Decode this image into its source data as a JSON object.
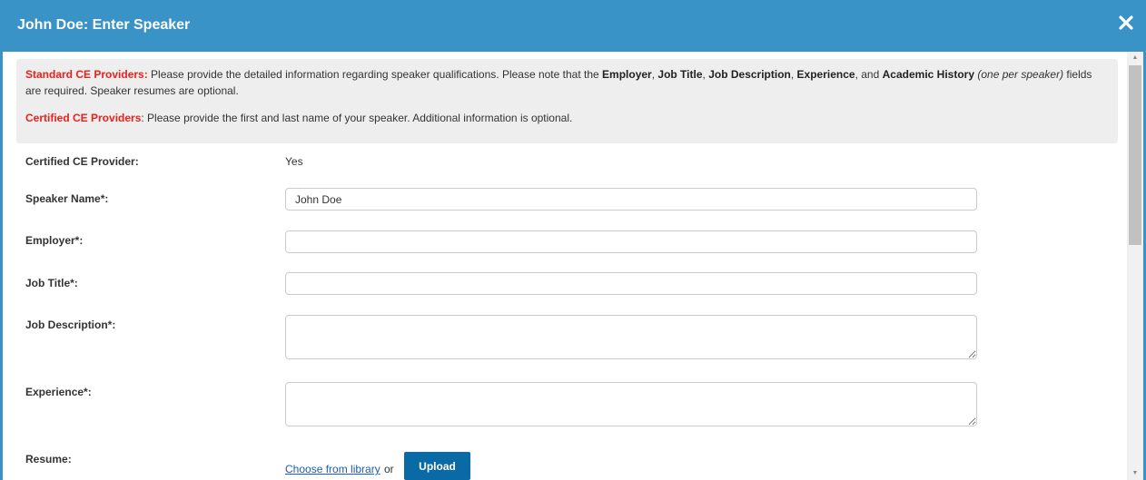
{
  "modal": {
    "title": "John Doe: Enter Speaker",
    "close_icon": "close-icon"
  },
  "notice": {
    "standard_label": "Standard CE Providers:",
    "standard_text_1": " Please provide the detailed information regarding speaker qualifications.  Please note that the ",
    "field_employer": "Employer",
    "sep_1": ", ",
    "field_job_title": "Job Title",
    "sep_2": ", ",
    "field_job_description": "Job Description",
    "sep_3": ", ",
    "field_experience": "Experience",
    "sep_4": ", and ",
    "field_academic_history": "Academic History",
    "sep_5": " ",
    "one_per_speaker": "(one per speaker)",
    "standard_text_2": " fields are required. Speaker resumes are optional.",
    "certified_label": "Certified CE Providers",
    "certified_text": ": Please provide the first and last name of your speaker. Additional information is optional."
  },
  "form": {
    "certified_label": "Certified CE Provider:",
    "certified_value": "Yes",
    "speaker_name_label": "Speaker Name*:",
    "speaker_name_value": "John Doe",
    "employer_label": "Employer*:",
    "employer_value": "",
    "job_title_label": "Job Title*:",
    "job_title_value": "",
    "job_description_label": "Job Description*:",
    "job_description_value": "",
    "experience_label": "Experience*:",
    "experience_value": "",
    "resume_label": "Resume:",
    "choose_library_link": "Choose from library",
    "or_text": "or",
    "upload_button": "Upload"
  },
  "colors": {
    "header_bg": "#3a93c6",
    "required_red": "#e8221d",
    "upload_button_bg": "#0a6aa6",
    "link": "#1e5bb0"
  }
}
